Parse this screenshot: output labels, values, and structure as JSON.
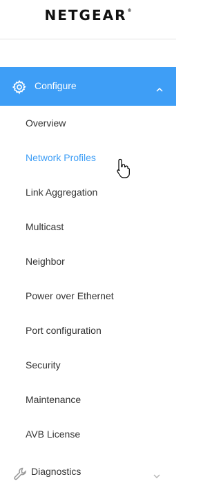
{
  "brand": {
    "name": "NETGEAR",
    "mark": "®"
  },
  "sidebar": {
    "configure": {
      "label": "Configure",
      "icon": "gear-icon",
      "expanded": true,
      "accent": "#3e9ef6"
    },
    "items": [
      {
        "label": "Overview"
      },
      {
        "label": "Network Profiles",
        "active": true
      },
      {
        "label": "Link Aggregation"
      },
      {
        "label": "Multicast"
      },
      {
        "label": "Neighbor"
      },
      {
        "label": "Power over Ethernet"
      },
      {
        "label": "Port configuration"
      },
      {
        "label": "Security"
      },
      {
        "label": "Maintenance"
      },
      {
        "label": "AVB License"
      }
    ],
    "diagnostics": {
      "label": "Diagnostics",
      "icon": "wrench-icon",
      "expanded": false
    }
  }
}
